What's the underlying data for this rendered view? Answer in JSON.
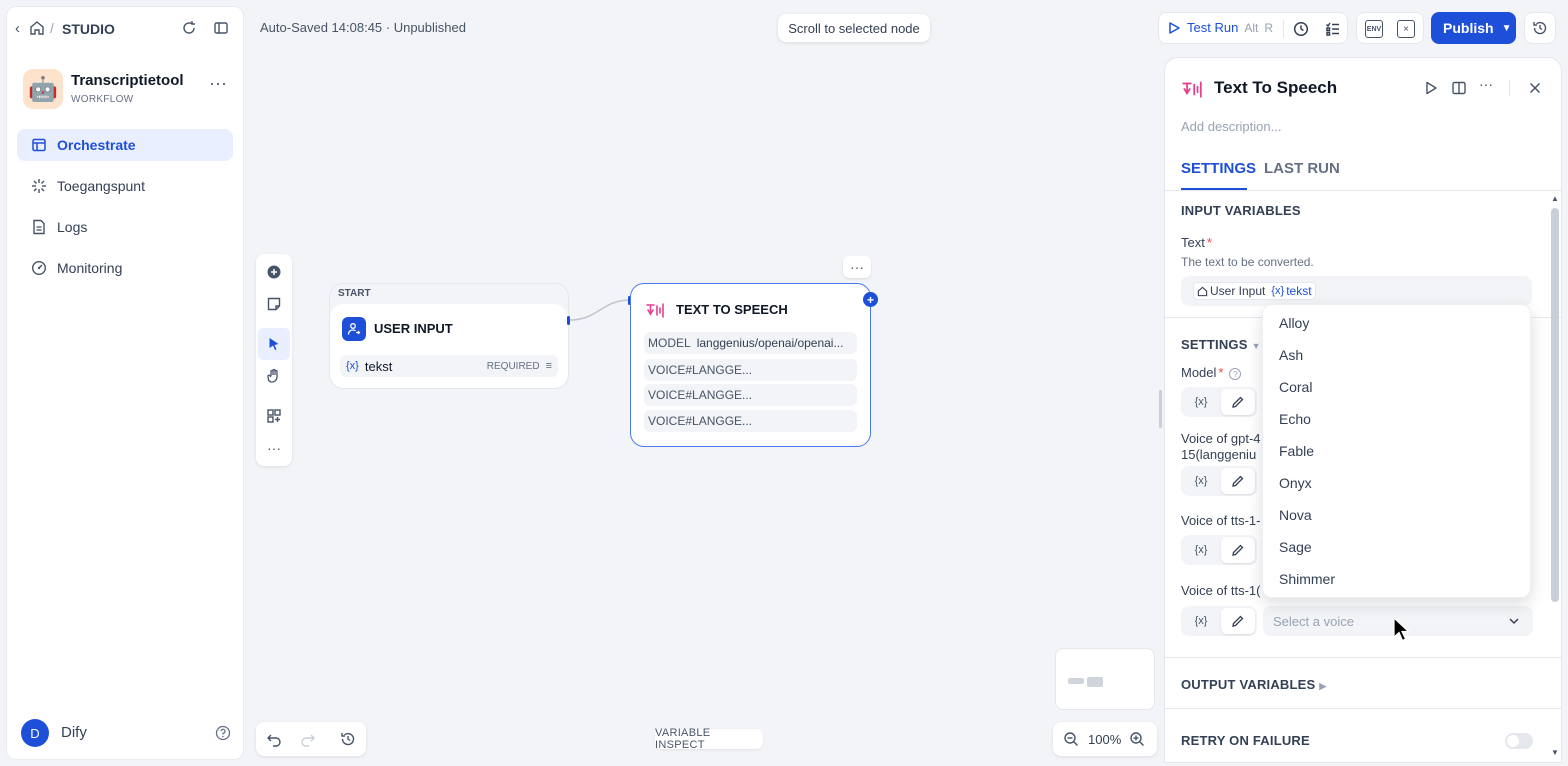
{
  "sidebar": {
    "breadcrumb": "STUDIO",
    "app": {
      "avatar": "🤖",
      "name": "Transcriptietool",
      "type": "WORKFLOW"
    },
    "nav": [
      {
        "label": "Orchestrate",
        "icon": "orchestrate-icon",
        "active": true
      },
      {
        "label": "Toegangspunt",
        "icon": "access-point-icon",
        "active": false
      },
      {
        "label": "Logs",
        "icon": "logs-icon",
        "active": false
      },
      {
        "label": "Monitoring",
        "icon": "monitoring-icon",
        "active": false
      }
    ],
    "user": {
      "initial": "D",
      "name": "Dify"
    }
  },
  "topbar": {
    "autosave": "Auto-Saved 14:08:45 · Unpublished",
    "scroll_to_node": "Scroll to selected node",
    "test_run": "Test Run",
    "shortcut_alt": "Alt",
    "shortcut_key": "R",
    "env": "ENV",
    "publish": "Publish"
  },
  "canvas": {
    "start_node": {
      "header": "START",
      "title": "USER INPUT",
      "var_prefix": "{x}",
      "var_name": "tekst",
      "required": "REQUIRED"
    },
    "tts_node": {
      "title": "TEXT TO SPEECH",
      "model_label": "MODEL",
      "model_value": "langgenius/openai/openai...",
      "voices": [
        "VOICE#LANGGE...",
        "VOICE#LANGGE...",
        "VOICE#LANGGE..."
      ]
    },
    "variable_inspect": "VARIABLE INSPECT",
    "zoom": "100%"
  },
  "panel": {
    "title": "Text To Speech",
    "description_placeholder": "Add description...",
    "tabs": [
      "SETTINGS",
      "LAST RUN"
    ],
    "input_variables": "INPUT VARIABLES",
    "text_label": "Text",
    "text_hint": "The text to be converted.",
    "text_value": {
      "source": "User Input",
      "prefix": "{x}",
      "var": "tekst"
    },
    "settings": "SETTINGS",
    "model_label": "Model",
    "voice1_label_line1": "Voice of gpt-4",
    "voice1_label_line2": "15(langgeniu",
    "voice2_label": "Voice of tts-1-",
    "voice3_label": "Voice of tts-1(",
    "mode_prefix": "{x}",
    "select_placeholder": "Select a voice",
    "output_variables": "OUTPUT VARIABLES",
    "retry_on_failure": "RETRY ON FAILURE"
  },
  "dropdown": {
    "options": [
      "Alloy",
      "Ash",
      "Coral",
      "Echo",
      "Fable",
      "Onyx",
      "Nova",
      "Sage",
      "Shimmer"
    ]
  },
  "colors": {
    "accent": "#1d4fd8",
    "tts_pink": "#e83e8c"
  }
}
